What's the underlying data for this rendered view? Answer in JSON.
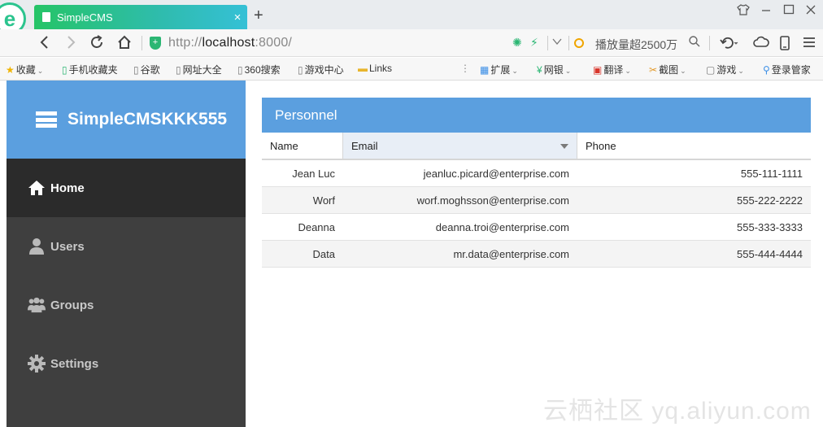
{
  "browser": {
    "tab_title": "SimpleCMS",
    "tab_close": "×",
    "new_tab": "+",
    "url_scheme": "http://",
    "url_host": "localhost",
    "url_rest": ":8000/",
    "search_placeholder": "播放量超2500万"
  },
  "bookmarks": {
    "left": [
      {
        "label": "收藏",
        "icon": "star-icon"
      },
      {
        "label": "手机收藏夹",
        "icon": "phone-icon"
      },
      {
        "label": "谷歌",
        "icon": "page-icon"
      },
      {
        "label": "网址大全",
        "icon": "page-icon"
      },
      {
        "label": "360搜索",
        "icon": "page-icon"
      },
      {
        "label": "游戏中心",
        "icon": "page-icon"
      },
      {
        "label": "Links",
        "icon": "folder-icon"
      }
    ],
    "right": [
      {
        "label": "扩展",
        "icon": "grid-icon"
      },
      {
        "label": "网银",
        "icon": "yen-icon"
      },
      {
        "label": "翻译",
        "icon": "translate-icon"
      },
      {
        "label": "截图",
        "icon": "scissors-icon"
      },
      {
        "label": "游戏",
        "icon": "gamepad-icon"
      },
      {
        "label": "登录管家",
        "icon": "key-icon"
      }
    ]
  },
  "app": {
    "brand": "SimpleCMSKKK555",
    "menu": [
      {
        "label": "Home",
        "icon": "home-icon",
        "active": true
      },
      {
        "label": "Users",
        "icon": "user-icon",
        "active": false
      },
      {
        "label": "Groups",
        "icon": "users-icon",
        "active": false
      },
      {
        "label": "Settings",
        "icon": "gear-icon",
        "active": false
      }
    ]
  },
  "personnel": {
    "title": "Personnel",
    "columns": [
      "Name",
      "Email",
      "Phone"
    ],
    "rows": [
      {
        "name": "Jean Luc",
        "email": "jeanluc.picard@enterprise.com",
        "phone": "555-111-1111"
      },
      {
        "name": "Worf",
        "email": "worf.moghsson@enterprise.com",
        "phone": "555-222-2222"
      },
      {
        "name": "Deanna",
        "email": "deanna.troi@enterprise.com",
        "phone": "555-333-3333"
      },
      {
        "name": "Data",
        "email": "mr.data@enterprise.com",
        "phone": "555-444-4444"
      }
    ]
  },
  "colors": {
    "accent": "#5b9fdf",
    "sidebar_bg": "#3f3f3f",
    "sidebar_active": "#2b2b2b"
  },
  "watermark": "云栖社区 yq.aliyun.com"
}
